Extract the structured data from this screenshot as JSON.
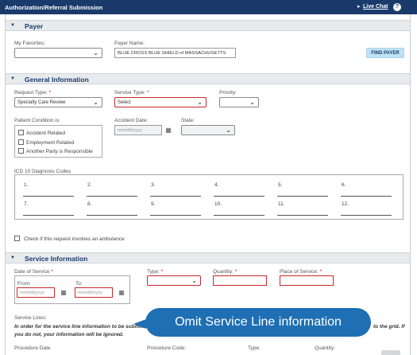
{
  "header": {
    "title": "Authorization/Referral Submission",
    "live_chat": "Live Chat",
    "live_chat_arrow": "▸",
    "help_label": "?"
  },
  "payer": {
    "section_title": "Payer",
    "favorites_label": "My Favorites:",
    "favorites_value": "",
    "payer_name_label": "Payer Name:",
    "payer_name_value": "BLUE CROSS BLUE SHIELD of MASSACHUSETTS",
    "find_payer_label": "FIND PAYER"
  },
  "general": {
    "section_title": "General Information",
    "request_type_label": "Request Type:",
    "request_type_value": "Specialty Care Review",
    "service_type_label": "Service Type:",
    "service_type_value": "Select",
    "priority_label": "Priority:",
    "priority_value": "",
    "patient_condition_label": "Patient Condition is:",
    "conditions": [
      "Accident Related",
      "Employment Related",
      "Another Party is Responsible"
    ],
    "accident_date_label": "Accident Date:",
    "accident_date_placeholder": "mm/dd/yyyy",
    "state_label": "State:",
    "state_value": "",
    "icd_label": "ICD 10 Diagnosis Codes",
    "icd_numbers": [
      "1.",
      "2.",
      "3.",
      "4.",
      "5.",
      "6.",
      "7.",
      "8.",
      "9.",
      "10.",
      "11.",
      "12."
    ],
    "ambulance_label": "Check if this request involves an ambulance"
  },
  "service": {
    "section_title": "Service Information",
    "date_of_service_label": "Date of Service",
    "from_label": "From:",
    "to_label": "To:",
    "from_placeholder": "mm/dd/yyyy",
    "to_placeholder": "mm/dd/yyyy",
    "type_label": "Type:",
    "type_value": "",
    "quantity_label": "Quantity:",
    "quantity_value": "",
    "place_label": "Place of Service:",
    "place_value": "",
    "service_lines_label": "Service Lines:",
    "notice_left": "In order for the service line information to be submitte",
    "notice_right": "to the grid. If",
    "notice_line2": "you do not, your information will be ignored.",
    "procedure_date_label": "Procedure Date",
    "procedure_code_label": "Procedure Code:",
    "line_type_label": "Type:",
    "line_quantity_label": "Quantity:"
  },
  "callout": {
    "text": "Omit Service Line information"
  },
  "required_mark": "*",
  "icons": {
    "dropdown": "chevron-down-icon",
    "calendar": "calendar-icon",
    "section_toggle": "caret-down-icon",
    "help": "help-icon"
  },
  "colors": {
    "header_bg": "#1a3a6b",
    "section_bg": "#e8ebee",
    "error_border": "#c8282a",
    "button_bg": "#bfe3f4",
    "callout_bg": "#1e6fb3"
  }
}
